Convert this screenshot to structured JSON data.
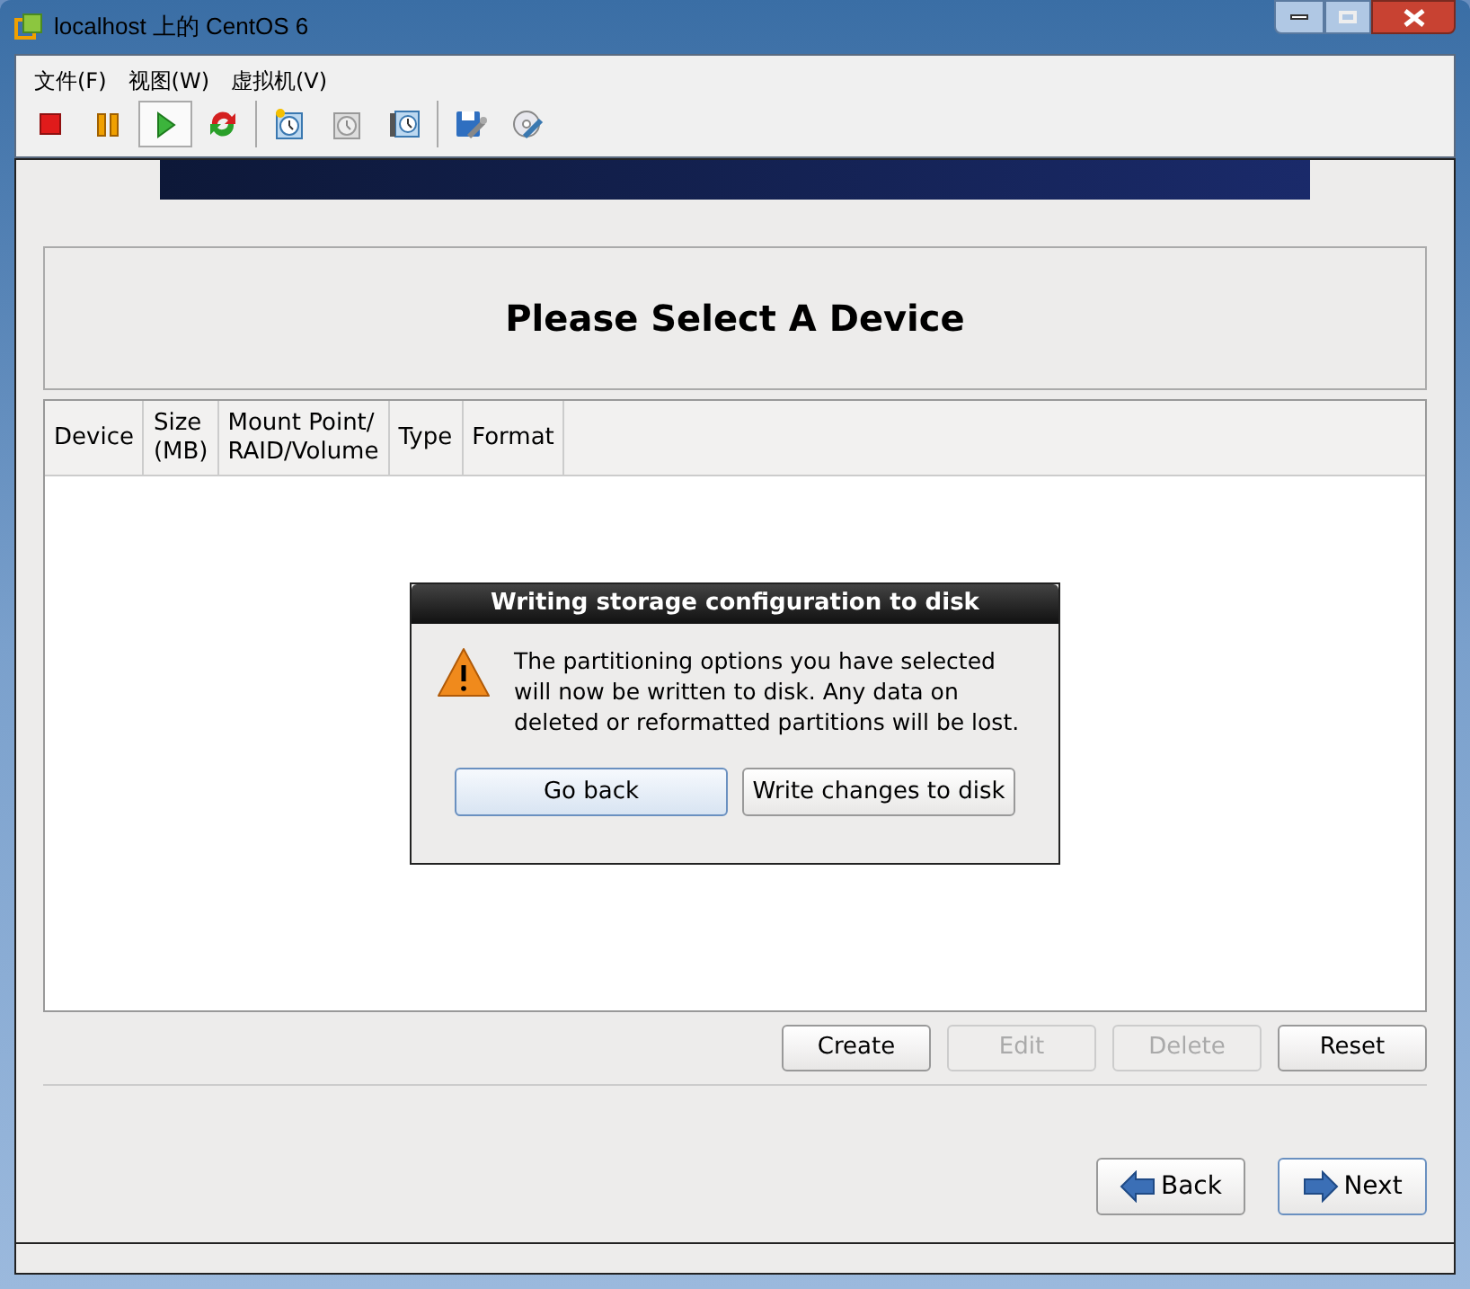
{
  "window": {
    "title": "localhost 上的 CentOS 6"
  },
  "menu": [
    "文件(F)",
    "视图(W)",
    "虚拟机(V)"
  ],
  "toolbar": [
    [
      {
        "kind": "stop",
        "selected": false
      },
      {
        "kind": "pause",
        "selected": false
      },
      {
        "kind": "play",
        "selected": true
      },
      {
        "kind": "reset",
        "selected": false
      }
    ],
    [
      {
        "kind": "snapshot",
        "selected": false
      },
      {
        "kind": "revert",
        "selected": false
      },
      {
        "kind": "manager",
        "selected": false
      }
    ],
    [
      {
        "kind": "settings",
        "selected": false
      },
      {
        "kind": "disc",
        "selected": false
      }
    ]
  ],
  "heading": "Please Select A Device",
  "table": {
    "columns": [
      [
        "Device"
      ],
      [
        "Size",
        "(MB)"
      ],
      [
        "Mount Point/",
        "RAID/Volume"
      ],
      [
        "Type"
      ],
      [
        "Format"
      ]
    ]
  },
  "dialog": {
    "title": "Writing storage configuration to disk",
    "message": "The partitioning options you have selected will now be written to disk.  Any data on deleted or reformatted partitions will be lost.",
    "buttons": [
      {
        "label": "Go back",
        "focused": true
      },
      {
        "label": "Write changes to disk",
        "focused": false
      }
    ]
  },
  "actions": [
    {
      "label": "Create",
      "disabled": false
    },
    {
      "label": "Edit",
      "disabled": true
    },
    {
      "label": "Delete",
      "disabled": true
    },
    {
      "label": "Reset",
      "disabled": false
    }
  ],
  "nav": [
    {
      "label": "Back",
      "kind": "back",
      "focused": false
    },
    {
      "label": "Next",
      "kind": "next",
      "focused": true
    }
  ]
}
